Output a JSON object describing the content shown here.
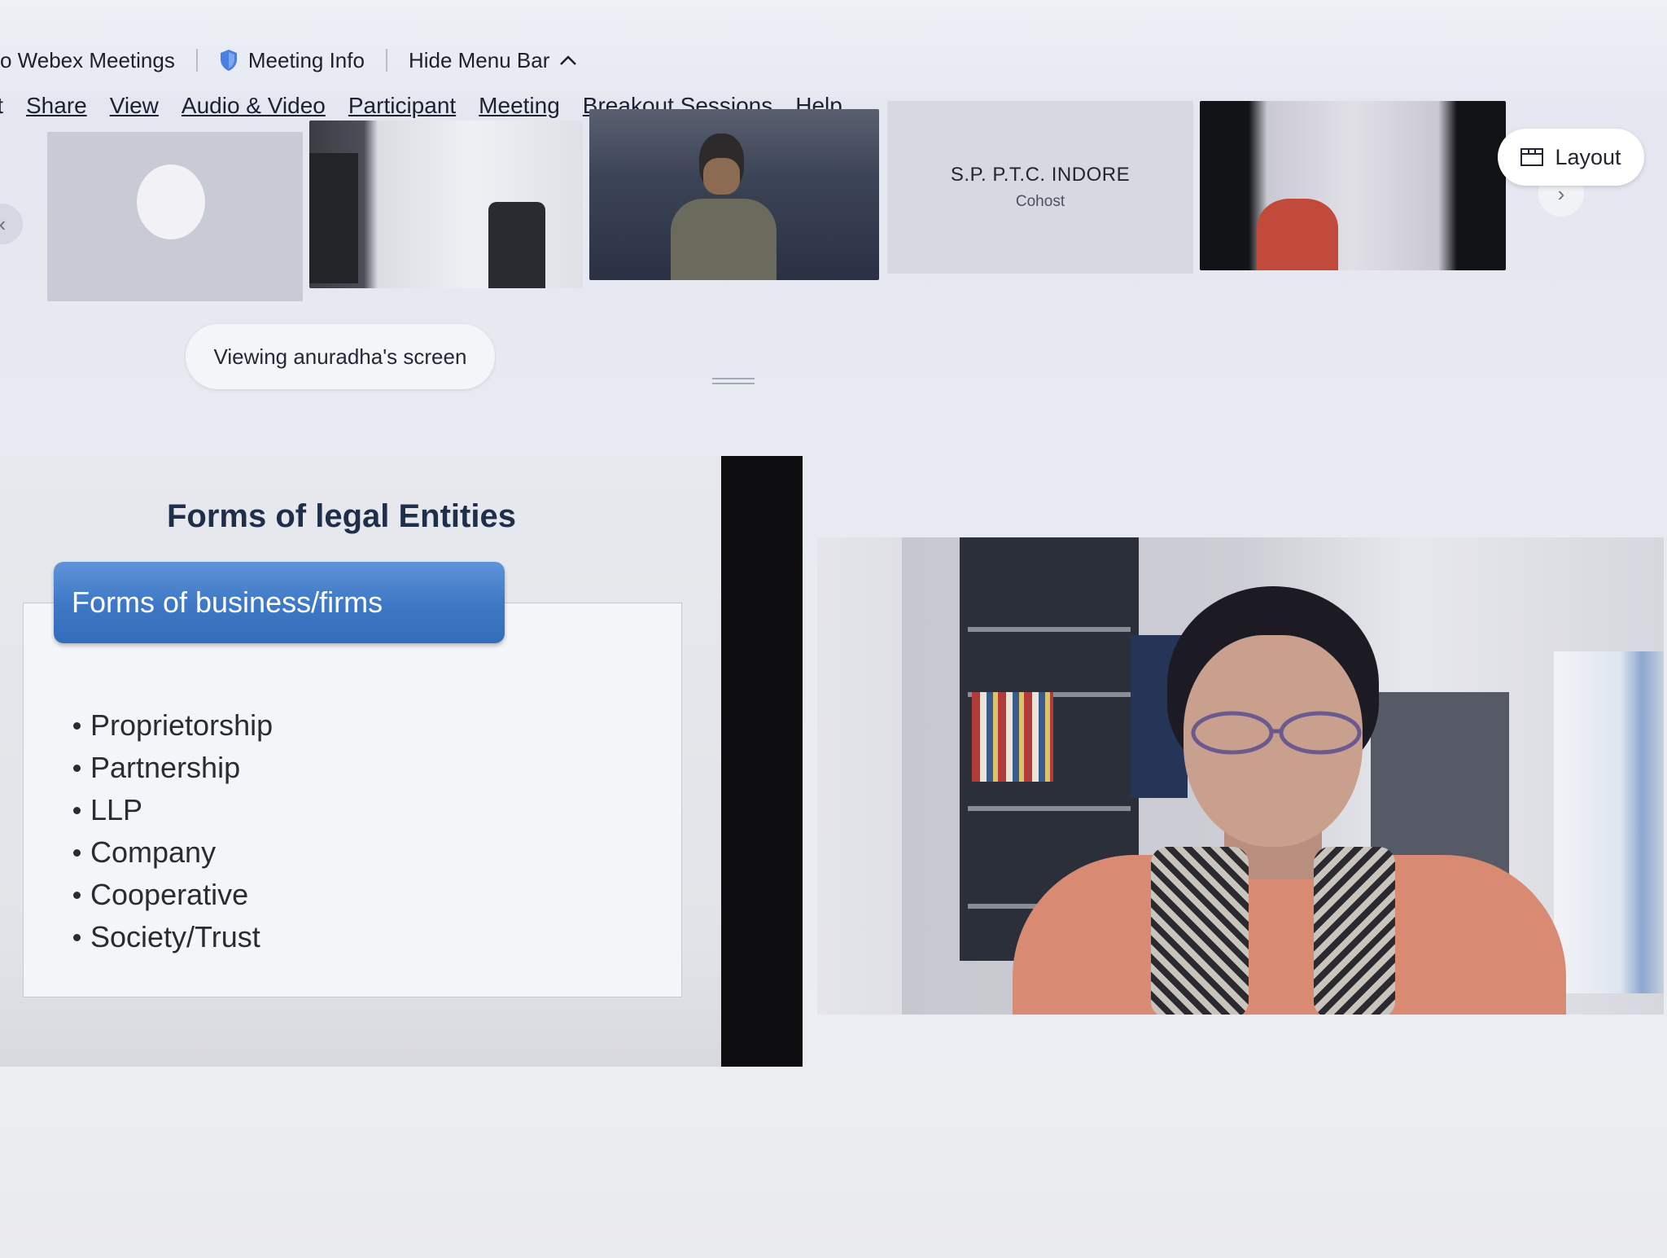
{
  "titlebar": {
    "app_name": "o Webex Meetings",
    "meeting_info_label": "Meeting Info",
    "hide_menu_label": "Hide Menu Bar"
  },
  "menu": {
    "items": [
      {
        "label": "it"
      },
      {
        "label": "Share"
      },
      {
        "label": "View"
      },
      {
        "label": "Audio & Video"
      },
      {
        "label": "Participant"
      },
      {
        "label": "Meeting"
      },
      {
        "label": "Breakout Sessions"
      },
      {
        "label": "Help"
      }
    ]
  },
  "participants": {
    "tile4": {
      "name": "S.P. P.T.C. INDORE",
      "role": "Cohost"
    }
  },
  "layout_button": {
    "label": "Layout"
  },
  "viewing_label": "Viewing anuradha's screen",
  "slide": {
    "title": "Forms of legal Entities",
    "tab_label": "Forms of business/firms",
    "bullets": [
      "Proprietorship",
      "Partnership",
      "LLP",
      "Company",
      "Cooperative",
      "Society/Trust"
    ]
  },
  "colors": {
    "accent_blue": "#3f79c6",
    "slide_title": "#1f2e4b",
    "shield": "#4a7fe0"
  },
  "icons": {
    "meeting_info": "shield-icon",
    "hide_menu": "chevron-up-icon",
    "layout": "layout-grid-icon",
    "strip_prev": "chevron-left-icon",
    "strip_next": "chevron-right-icon"
  }
}
